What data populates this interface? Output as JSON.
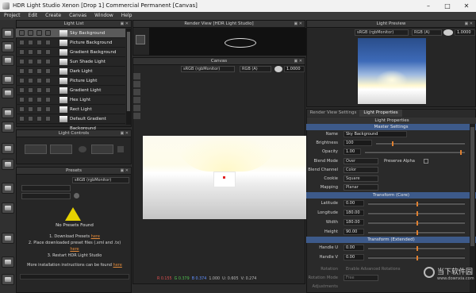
{
  "window": {
    "title": "HDR Light Studio Xenon [Drop 1]  Commercial Permanent [Canvas]"
  },
  "menu": [
    "Project",
    "Edit",
    "Create",
    "Canvas",
    "Window",
    "Help"
  ],
  "light_list": {
    "title": "Light List",
    "items": [
      {
        "name": "Sky Background",
        "selected": true
      },
      {
        "name": "Picture Background"
      },
      {
        "name": "Gradient Background"
      },
      {
        "name": "Sun Shade Light"
      },
      {
        "name": "Dark Light"
      },
      {
        "name": "Picture Light"
      },
      {
        "name": "Gradient Light"
      },
      {
        "name": "Hex Light"
      },
      {
        "name": "Rect Light"
      },
      {
        "name": "Default Gradient Background"
      }
    ]
  },
  "light_controls": {
    "title": "Light Controls"
  },
  "presets": {
    "title": "Presets",
    "colorspace": "sRGB (rgbMonitor)",
    "no_presets": "No Presets Found",
    "step1": "1. Download Presets",
    "step2": "2. Place downloaded preset files (.xml and .tx)",
    "step3": "3. Restart HDR Light Studio",
    "more": "More installation instructions can be found",
    "here": "here"
  },
  "render_view": {
    "title": "Render View [HDR Light Studio]"
  },
  "canvas": {
    "title": "Canvas",
    "colorspace": "sRGB (rgbMonitor)",
    "channel": "RGB (A)",
    "exposure": "1.0000",
    "status": {
      "r": "R 0.155",
      "g": "G 0.379",
      "b": "B 0.374",
      "a": "1.000",
      "u": "U: 0.605",
      "v": "V: 0.274"
    }
  },
  "light_preview": {
    "title": "Light Preview",
    "colorspace": "sRGB (rgbMonitor)",
    "channel": "RGB (A)",
    "exposure": "1.0000"
  },
  "properties": {
    "tabs": [
      "Render View Settings",
      "Light Properties"
    ],
    "header": "Light Properties",
    "master": "Master Settings",
    "name_label": "Name",
    "name": "Sky Background",
    "brightness_label": "Brightness",
    "brightness": "100",
    "opacity_label": "Opacity",
    "opacity": "1.00",
    "blend_mode_label": "Blend Mode",
    "blend_mode": "Over",
    "preserve_alpha_label": "Preserve Alpha",
    "blend_channel_label": "Blend Channel",
    "blend_channel": "Color",
    "cookie_label": "Cookie",
    "cookie": "Square",
    "mapping_label": "Mapping",
    "mapping": "Planar",
    "transform_core": "Transform (Core)",
    "latitude_label": "Latitude",
    "latitude": "0.00",
    "longitude_label": "Longitude",
    "longitude": "180.00",
    "width_label": "Width",
    "width": "180.00",
    "height_label": "Height",
    "height": "90.00",
    "transform_ext": "Transform (Extended)",
    "handle_u_label": "Handle U",
    "handle_u": "0.00",
    "handle_v_label": "Handle V",
    "handle_v": "0.00",
    "rotation_label": "Rotation",
    "enable_adv": "Enable Advanced Rotations",
    "rotation_mode_label": "Rotation Mode",
    "rotation_mode": "Free",
    "last_label": "Adjustments"
  },
  "watermark": {
    "site": "当下软件园",
    "url": "www.downxia.com"
  },
  "colors": {
    "accent_orange": "#e08030",
    "section_blue": "#3d5a8a",
    "warning_yellow": "#e6d200"
  }
}
